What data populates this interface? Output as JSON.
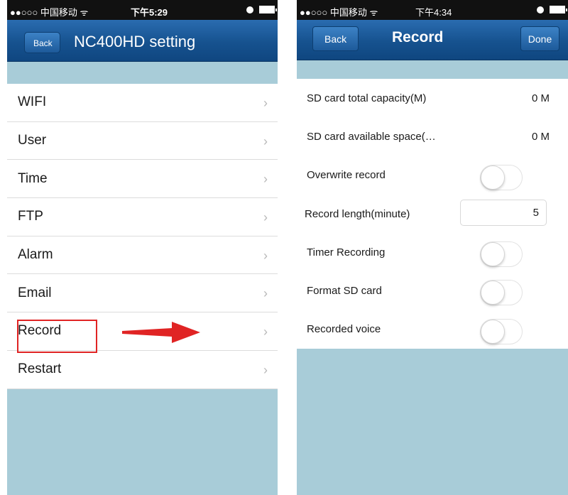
{
  "left": {
    "status": {
      "carrier": "●●○○○ 中国移动 ᯤ",
      "time": "下午5:29"
    },
    "nav": {
      "back_label": "Back",
      "title": "NC400HD setting"
    },
    "menu": [
      {
        "label": "WIFI"
      },
      {
        "label": "User"
      },
      {
        "label": "Time"
      },
      {
        "label": "FTP"
      },
      {
        "label": "Alarm"
      },
      {
        "label": "Email"
      },
      {
        "label": "Record"
      },
      {
        "label": "Restart"
      }
    ],
    "chevron": "›",
    "annotation": {
      "highlighted_item": "Record",
      "box_color": "#e02424",
      "arrow_color": "#e02424"
    }
  },
  "right": {
    "status": {
      "carrier": "●●○○○ 中国移动 ᯤ",
      "time": "下午4:34"
    },
    "nav": {
      "back_label": "Back",
      "title": "Record",
      "done_label": "Done"
    },
    "settings": [
      {
        "label": "SD card total capacity(M)",
        "value": "0 M"
      },
      {
        "label": "SD card available space(…",
        "value": "0 M"
      },
      {
        "label": "Overwrite record",
        "toggle": "off"
      },
      {
        "label": "Record length(minute)",
        "input_value": "5"
      },
      {
        "label": "Timer Recording",
        "toggle": "off"
      },
      {
        "label": "Format SD card",
        "toggle": "off"
      },
      {
        "label": "Recorded voice",
        "toggle": "off"
      }
    ]
  },
  "colors": {
    "nav_bar": "#16528f",
    "page_background": "#a8ccd8",
    "status_bar": "#111111"
  },
  "icons": {
    "alarm": "alarm-icon",
    "battery": "battery-icon",
    "disclosure": "chevron-right-icon"
  }
}
